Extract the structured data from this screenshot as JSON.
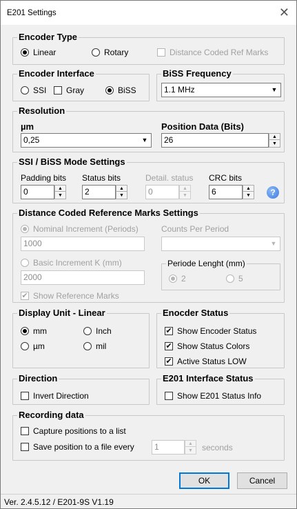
{
  "window": {
    "title": "E201 Settings",
    "close_glyph": "✕"
  },
  "encoder_type": {
    "legend": "Encoder Type",
    "linear": "Linear",
    "rotary": "Rotary",
    "distance_coded": "Distance Coded Ref Marks",
    "selected": "Linear"
  },
  "encoder_interface": {
    "legend": "Encoder Interface",
    "ssi": "SSI",
    "gray": "Gray",
    "biss": "BiSS",
    "selected": "BiSS"
  },
  "biss_frequency": {
    "legend": "BiSS Frequency",
    "value": "1.1 MHz"
  },
  "resolution": {
    "legend": "Resolution",
    "unit_label": "µm",
    "unit_value": "0,25",
    "position_label": "Position Data (Bits)",
    "position_value": "26"
  },
  "ssi_biss": {
    "legend": "SSI / BiSS Mode Settings",
    "padding_label": "Padding bits",
    "padding_value": "0",
    "status_label": "Status bits",
    "status_value": "2",
    "detail_label": "Detail. status",
    "detail_value": "0",
    "crc_label": "CRC bits",
    "crc_value": "6",
    "help_glyph": "?"
  },
  "distance_coded": {
    "legend": "Distance Coded Reference Marks Settings",
    "nominal_label": "Nominal Increment (Periods)",
    "nominal_value": "1000",
    "counts_label": "Counts Per Period",
    "counts_value": "",
    "basic_label": "Basic Increment K (mm)",
    "basic_value": "2000",
    "periode_legend": "Periode Lenght (mm)",
    "periode_2": "2",
    "periode_5": "5",
    "show_marks": "Show Reference Marks"
  },
  "display_unit": {
    "legend": "Display Unit - Linear",
    "mm": "mm",
    "inch": "Inch",
    "um": "µm",
    "mil": "mil",
    "selected": "mm"
  },
  "encoder_status": {
    "legend": "Enocder Status",
    "show_status": "Show Encoder Status",
    "show_colors": "Show Status Colors",
    "active_low": "Active Status LOW"
  },
  "direction": {
    "legend": "Direction",
    "invert": "Invert Direction"
  },
  "interface_status": {
    "legend": "E201 Interface Status",
    "show_info": "Show E201 Status Info"
  },
  "recording": {
    "legend": "Recording data",
    "capture": "Capture positions to a list",
    "save": "Save position to a file every",
    "interval": "1",
    "seconds": "seconds"
  },
  "buttons": {
    "ok": "OK",
    "cancel": "Cancel"
  },
  "status_bar": {
    "version": "Ver. 2.4.5.12 / E201-9S V1.19"
  },
  "colors": {
    "dialog_bg": "#f0f0f0",
    "accent": "#0078d7",
    "help_icon": "#3d7be0"
  }
}
